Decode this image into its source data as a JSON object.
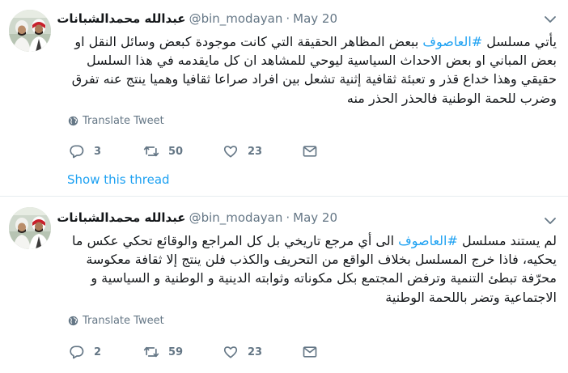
{
  "tweets": [
    {
      "author": {
        "name": "عبدالله محمدالشبانات",
        "handle": "@bin_modayan",
        "date": "May 20"
      },
      "body": {
        "prefix": "يأتي مسلسل ",
        "hashtag": "#العاصوف",
        "suffix": " ببعض المظاهر الحقيقة التي كانت موجودة كبعض وسائل النقل او بعض المباني او بعض الاحداث السياسية ليوحي للمشاهد ان كل مايقدمه في هذا السلسل حقيقي وهذا خداع قذر و تعبئة ثقافية إثنية تشعل بين افراد صراعا ثقافيا وهميا ينتج عنه تفرق وضرب للحمة الوطنية فالحذر الحذر منه"
      },
      "translate_label": "Translate Tweet",
      "counts": {
        "replies": "3",
        "retweets": "50",
        "likes": "23"
      },
      "thread_label": "Show this thread"
    },
    {
      "author": {
        "name": "عبدالله محمدالشبانات",
        "handle": "@bin_modayan",
        "date": "May 20"
      },
      "body": {
        "prefix": "لم يستند مسلسل ",
        "hashtag": "#العاصوف",
        "suffix": " الى أي مرجع تاريخي بل كل المراجع والوقائع تحكي عكس ما يحكيه، فاذا خرج المسلسل بخلاف الواقع من التحريف والكذب فلن ينتج إلا ثقافة معكوسة محرّفة تبطئ التنمية وترفض المجتمع بكل مكوناته وثوابته الدينية و الوطنية و السياسية و الاجتماعية وتضر باللحمة الوطنية"
      },
      "translate_label": "Translate Tweet",
      "counts": {
        "replies": "2",
        "retweets": "59",
        "likes": "23"
      }
    }
  ],
  "icons": {
    "reply": "reply-icon",
    "retweet": "retweet-icon",
    "like": "heart-icon",
    "dm": "envelope-icon",
    "translate": "globe-icon",
    "menu": "chevron-down-icon"
  },
  "colors": {
    "link": "#1da1f2",
    "muted": "#657786",
    "text": "#14171a",
    "divider": "#e6ecf0"
  }
}
